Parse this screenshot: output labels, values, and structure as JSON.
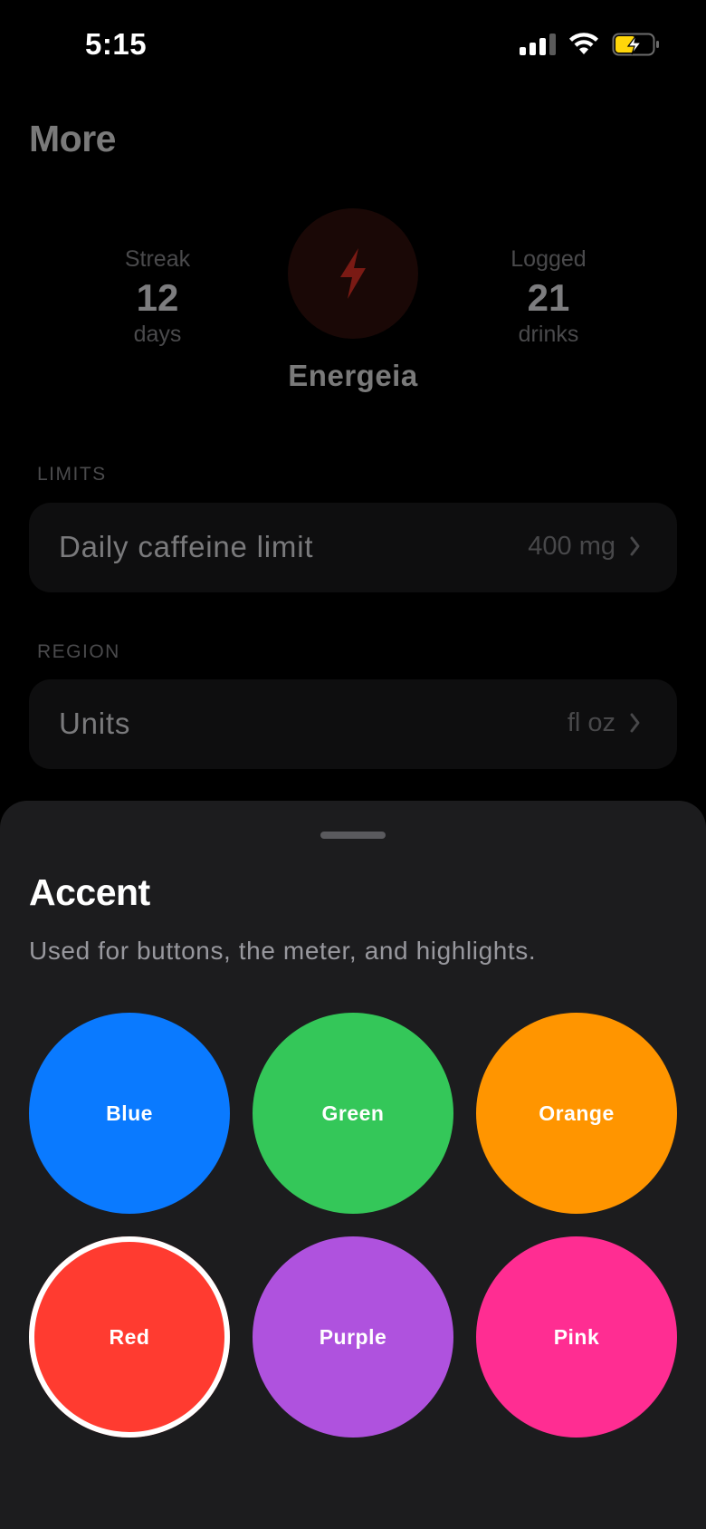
{
  "status_bar": {
    "time": "5:15"
  },
  "page": {
    "title": "More"
  },
  "stats": {
    "streak": {
      "label": "Streak",
      "value": "12",
      "unit": "days"
    },
    "logged": {
      "label": "Logged",
      "value": "21",
      "unit": "drinks"
    }
  },
  "app": {
    "name": "Energeia",
    "icon": "bolt-icon"
  },
  "sections": {
    "limits": {
      "header": "LIMITS",
      "row": {
        "label": "Daily caffeine limit",
        "value": "400 mg"
      }
    },
    "region": {
      "header": "REGION",
      "row": {
        "label": "Units",
        "value": "fl oz"
      }
    }
  },
  "sheet": {
    "title": "Accent",
    "subtitle": "Used for buttons, the meter, and highlights.",
    "selected": "Red",
    "options": [
      {
        "label": "Blue",
        "color": "#0A7AFF"
      },
      {
        "label": "Green",
        "color": "#34C759"
      },
      {
        "label": "Orange",
        "color": "#FF9500"
      },
      {
        "label": "Red",
        "color": "#FF3B30"
      },
      {
        "label": "Purple",
        "color": "#AF52DE"
      },
      {
        "label": "Pink",
        "color": "#FF2D92"
      }
    ]
  },
  "colors": {
    "background": "#000000",
    "sheet": "#1C1C1E",
    "battery_fill": "#FFD60A",
    "badge_bolt": "#7A1A14"
  }
}
